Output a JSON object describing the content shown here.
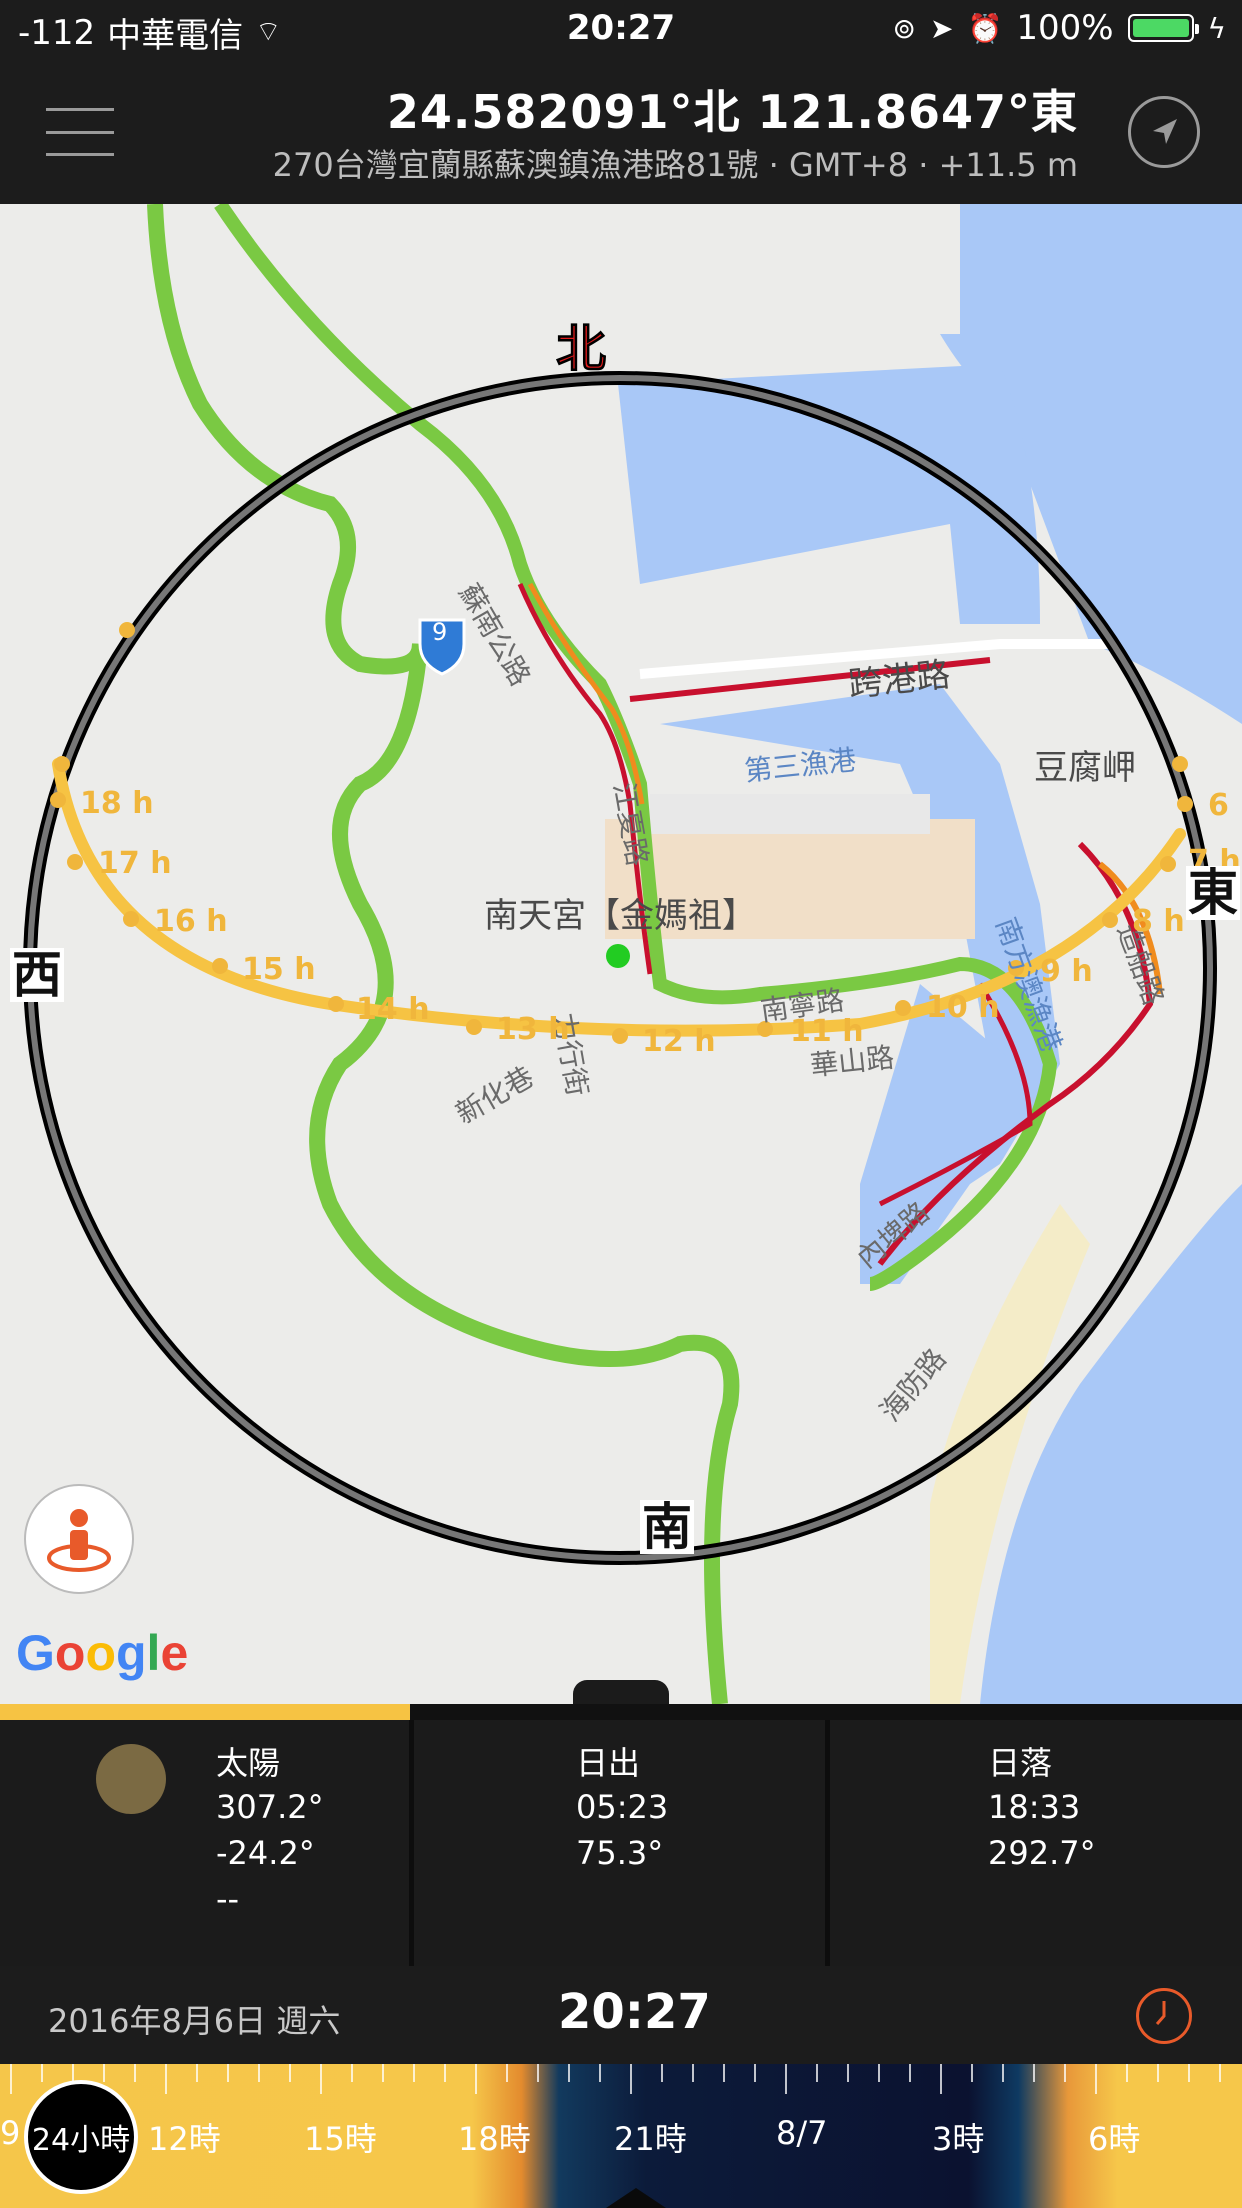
{
  "status_bar": {
    "signal": "-112",
    "carrier": "中華電信",
    "time": "20:27",
    "battery": "100%",
    "battery_level": 1.0
  },
  "header": {
    "coordinates": "24.582091°北  121.8647°東",
    "address": "270台灣宜蘭縣蘇澳鎮漁港路81號 · GMT+8 · +11.5 m"
  },
  "map": {
    "labels": {
      "su_nan_road": "蘇南公路",
      "kua_gang_road": "跨港路",
      "third_harbor": "第三漁港",
      "doufu_cape": "豆腐岬",
      "jiang_xia_road": "江夏路",
      "nantian_temple": "南天宮【金媽祖】",
      "nan_ning_road": "南寧路",
      "li_xing_street": "力行街",
      "xin_hua_lane": "新化巷",
      "hua_shan_road": "華山路",
      "nan_fang_harbor": "南方澳漁港",
      "zao_chuan_road": "造船路",
      "nei_pi_road": "內埤路",
      "ying_fu_road": "海防路",
      "route_9": "9"
    },
    "compass": {
      "north": "北",
      "south": "南",
      "east": "東",
      "west": "西"
    },
    "hours": [
      "6",
      "7 h",
      "8 h",
      "9 h",
      "10 h",
      "11 h",
      "12 h",
      "13 h",
      "14 h",
      "15 h",
      "16 h",
      "17 h",
      "18 h"
    ],
    "google_logo": "Google"
  },
  "info": {
    "day_progress": 0.33,
    "sun": {
      "title": "太陽",
      "azimuth": "307.2°",
      "elevation": "-24.2°",
      "extra": "--"
    },
    "sunrise": {
      "title": "日出",
      "time": "05:23",
      "azimuth": "75.3°"
    },
    "sunset": {
      "title": "日落",
      "time": "18:33",
      "azimuth": "292.7°"
    }
  },
  "datebar": {
    "date": "2016年8月6日 週六",
    "time": "20:27"
  },
  "timeline": {
    "dial": "24小時",
    "edge_label": "9",
    "labels": [
      "12時",
      "15時",
      "18時",
      "21時",
      "8/7",
      "3時",
      "6時"
    ]
  },
  "colors": {
    "sun_path": "#f6c343",
    "road_green": "#7ac943",
    "road_orange": "#f08c1e",
    "road_red": "#c8102e",
    "water": "#a9c8f7"
  }
}
